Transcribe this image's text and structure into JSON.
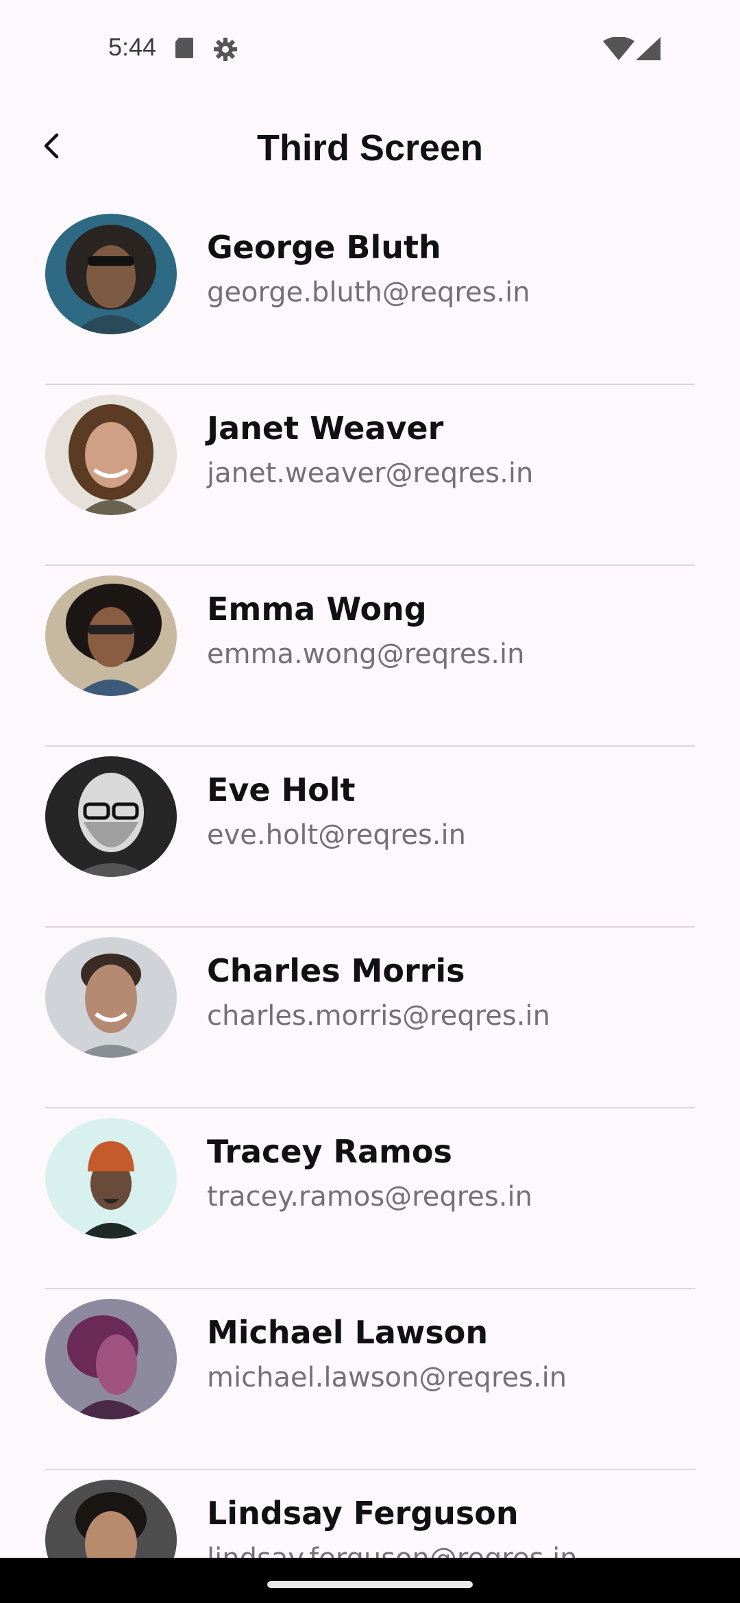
{
  "status_bar": {
    "time": "5:44",
    "icons": [
      "sd-card-icon",
      "gear-icon",
      "wifi-icon",
      "signal-icon"
    ]
  },
  "app_bar": {
    "back_icon": "chevron-left-icon",
    "title": "Third Screen"
  },
  "users": [
    {
      "name": "George Bluth",
      "email": "george.bluth@reqres.in",
      "avatar_colors": [
        "#2f6a84",
        "#2a2522",
        "#7d5a44"
      ]
    },
    {
      "name": "Janet Weaver",
      "email": "janet.weaver@reqres.in",
      "avatar_colors": [
        "#e5e1da",
        "#5b3b24",
        "#cf9f86"
      ]
    },
    {
      "name": "Emma Wong",
      "email": "emma.wong@reqres.in",
      "avatar_colors": [
        "#c7b8a0",
        "#1c1714",
        "#8a5d42"
      ]
    },
    {
      "name": "Eve Holt",
      "email": "eve.holt@reqres.in",
      "avatar_colors": [
        "#262626",
        "#d9d9d9",
        "#9f9f9f"
      ]
    },
    {
      "name": "Charles Morris",
      "email": "charles.morris@reqres.in",
      "avatar_colors": [
        "#d0d3d8",
        "#3a2c25",
        "#b58a73"
      ]
    },
    {
      "name": "Tracey Ramos",
      "email": "tracey.ramos@reqres.in",
      "avatar_colors": [
        "#d8f0ee",
        "#c55a2b",
        "#6a4a38"
      ]
    },
    {
      "name": "Michael Lawson",
      "email": "michael.lawson@reqres.in",
      "avatar_colors": [
        "#8d8aa0",
        "#6b2a57",
        "#a05280"
      ]
    },
    {
      "name": "Lindsay Ferguson",
      "email": "lindsay.ferguson@reqres.in",
      "avatar_colors": [
        "#4e4e4e",
        "#1a1614",
        "#b88b6c"
      ]
    }
  ]
}
